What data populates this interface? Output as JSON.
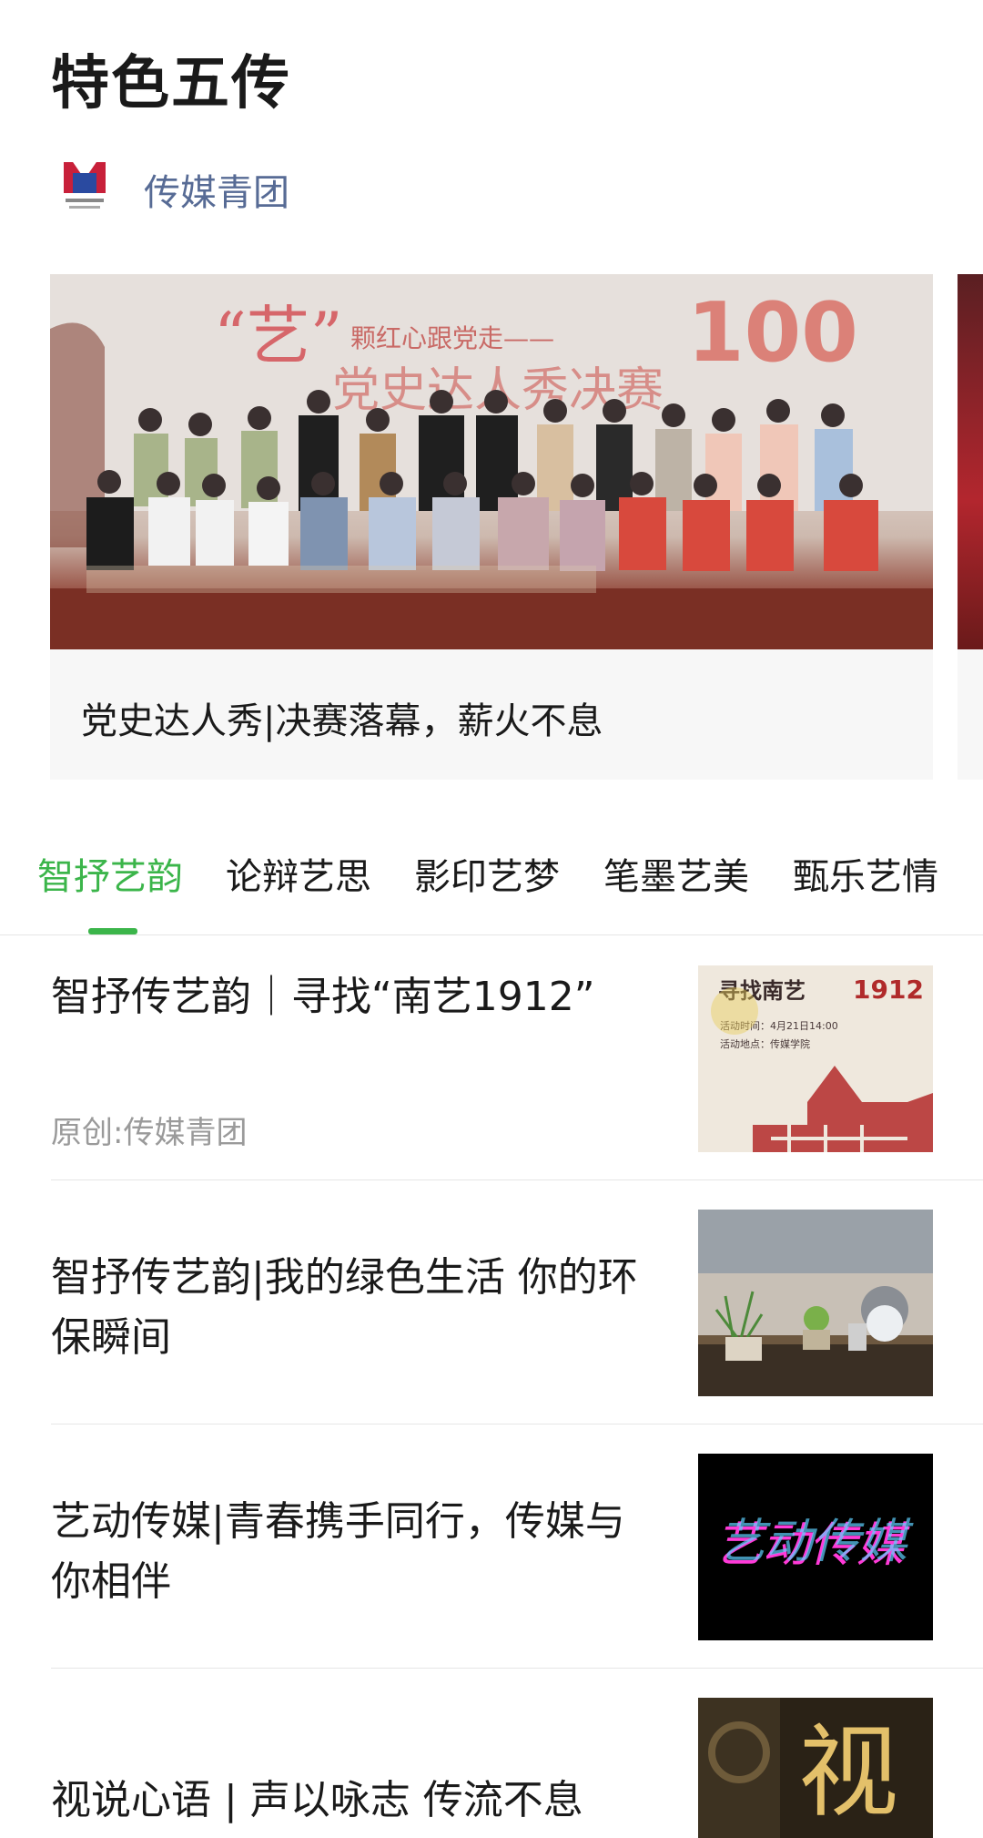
{
  "page": {
    "title": "特色五传"
  },
  "account": {
    "name": "传媒青团"
  },
  "featured": {
    "caption": "党史达人秀|决赛落幕，薪火不息",
    "banner_quote": "“艺”",
    "banner_subtitle": "颗红心跟党走——",
    "banner_title": "党史达人秀决赛",
    "banner_number": "100"
  },
  "tabs": [
    {
      "label": "智抒艺韵",
      "active": true
    },
    {
      "label": "论辩艺思",
      "active": false
    },
    {
      "label": "影印艺梦",
      "active": false
    },
    {
      "label": "笔墨艺美",
      "active": false
    },
    {
      "label": "甄乐艺情",
      "active": false
    }
  ],
  "articles": [
    {
      "title": "智抒传艺韵｜寻找“南艺1912”",
      "source": "原创:传媒青团",
      "thumb": {
        "heading": "寻找南艺",
        "year": "1912",
        "line1": "活动时间：4月21日14:00",
        "line2": "活动地点：传媒学院"
      }
    },
    {
      "title": "智抒传艺韵|我的绿色生活 你的环保瞬间",
      "source": ""
    },
    {
      "title": "艺动传媒|青春携手同行，传媒与你相伴",
      "source": "",
      "thumb": {
        "text": "艺动传媒"
      }
    },
    {
      "title": "视说心语 | 声以咏志 传流不息",
      "source": "",
      "thumb": {
        "text": "视"
      }
    }
  ],
  "colors": {
    "accent_green": "#3bb54a",
    "link_blue": "#576b95",
    "source_gray": "#9a9a9a"
  }
}
